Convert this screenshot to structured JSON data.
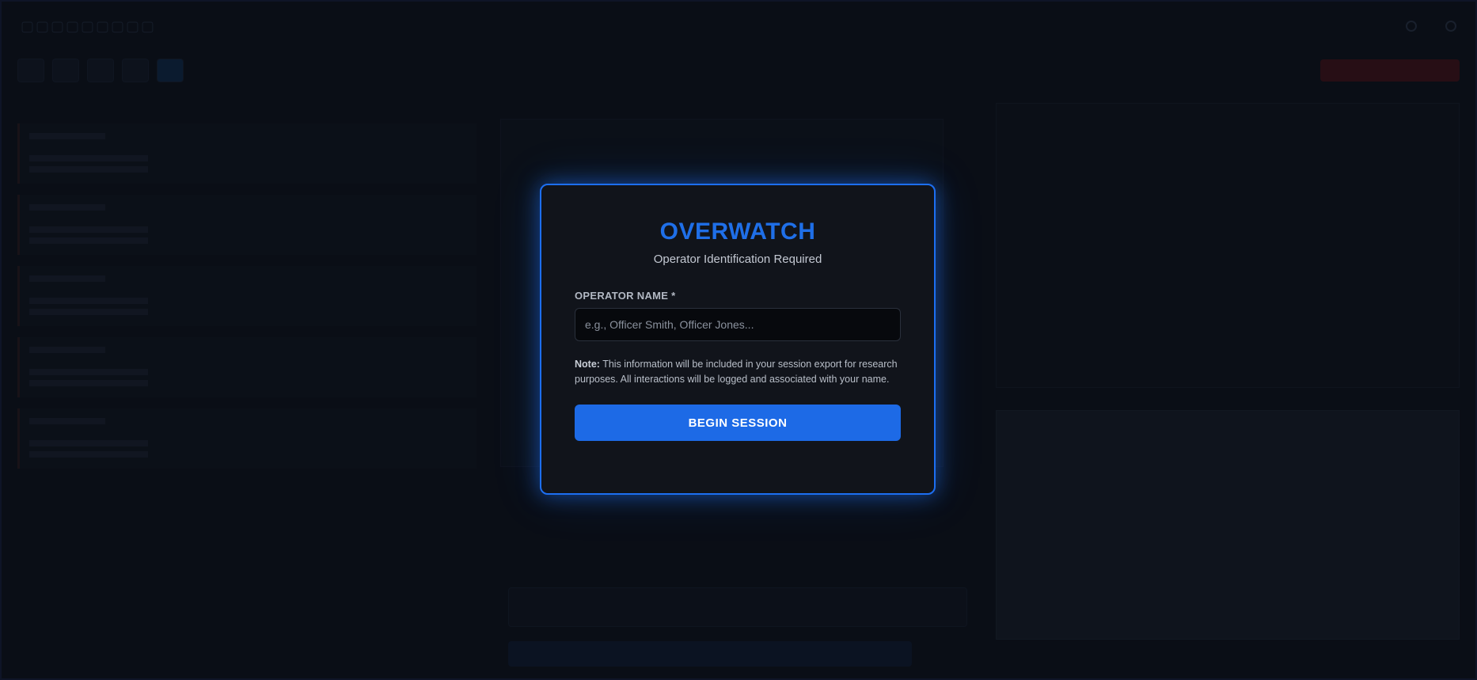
{
  "modal": {
    "title": "OVERWATCH",
    "subtitle": "Operator Identification Required",
    "field_label": "OPERATOR NAME *",
    "name_placeholder": "e.g., Officer Smith, Officer Jones...",
    "name_value": "",
    "note_label": "Note:",
    "note_text": " This information will be included in your session export for research purposes. All interactions will be logged and associated with your name.",
    "submit_label": "BEGIN SESSION"
  },
  "colors": {
    "accent": "#1d6ae6",
    "modal_border": "#1d6ff2",
    "background": "#0d1119"
  }
}
